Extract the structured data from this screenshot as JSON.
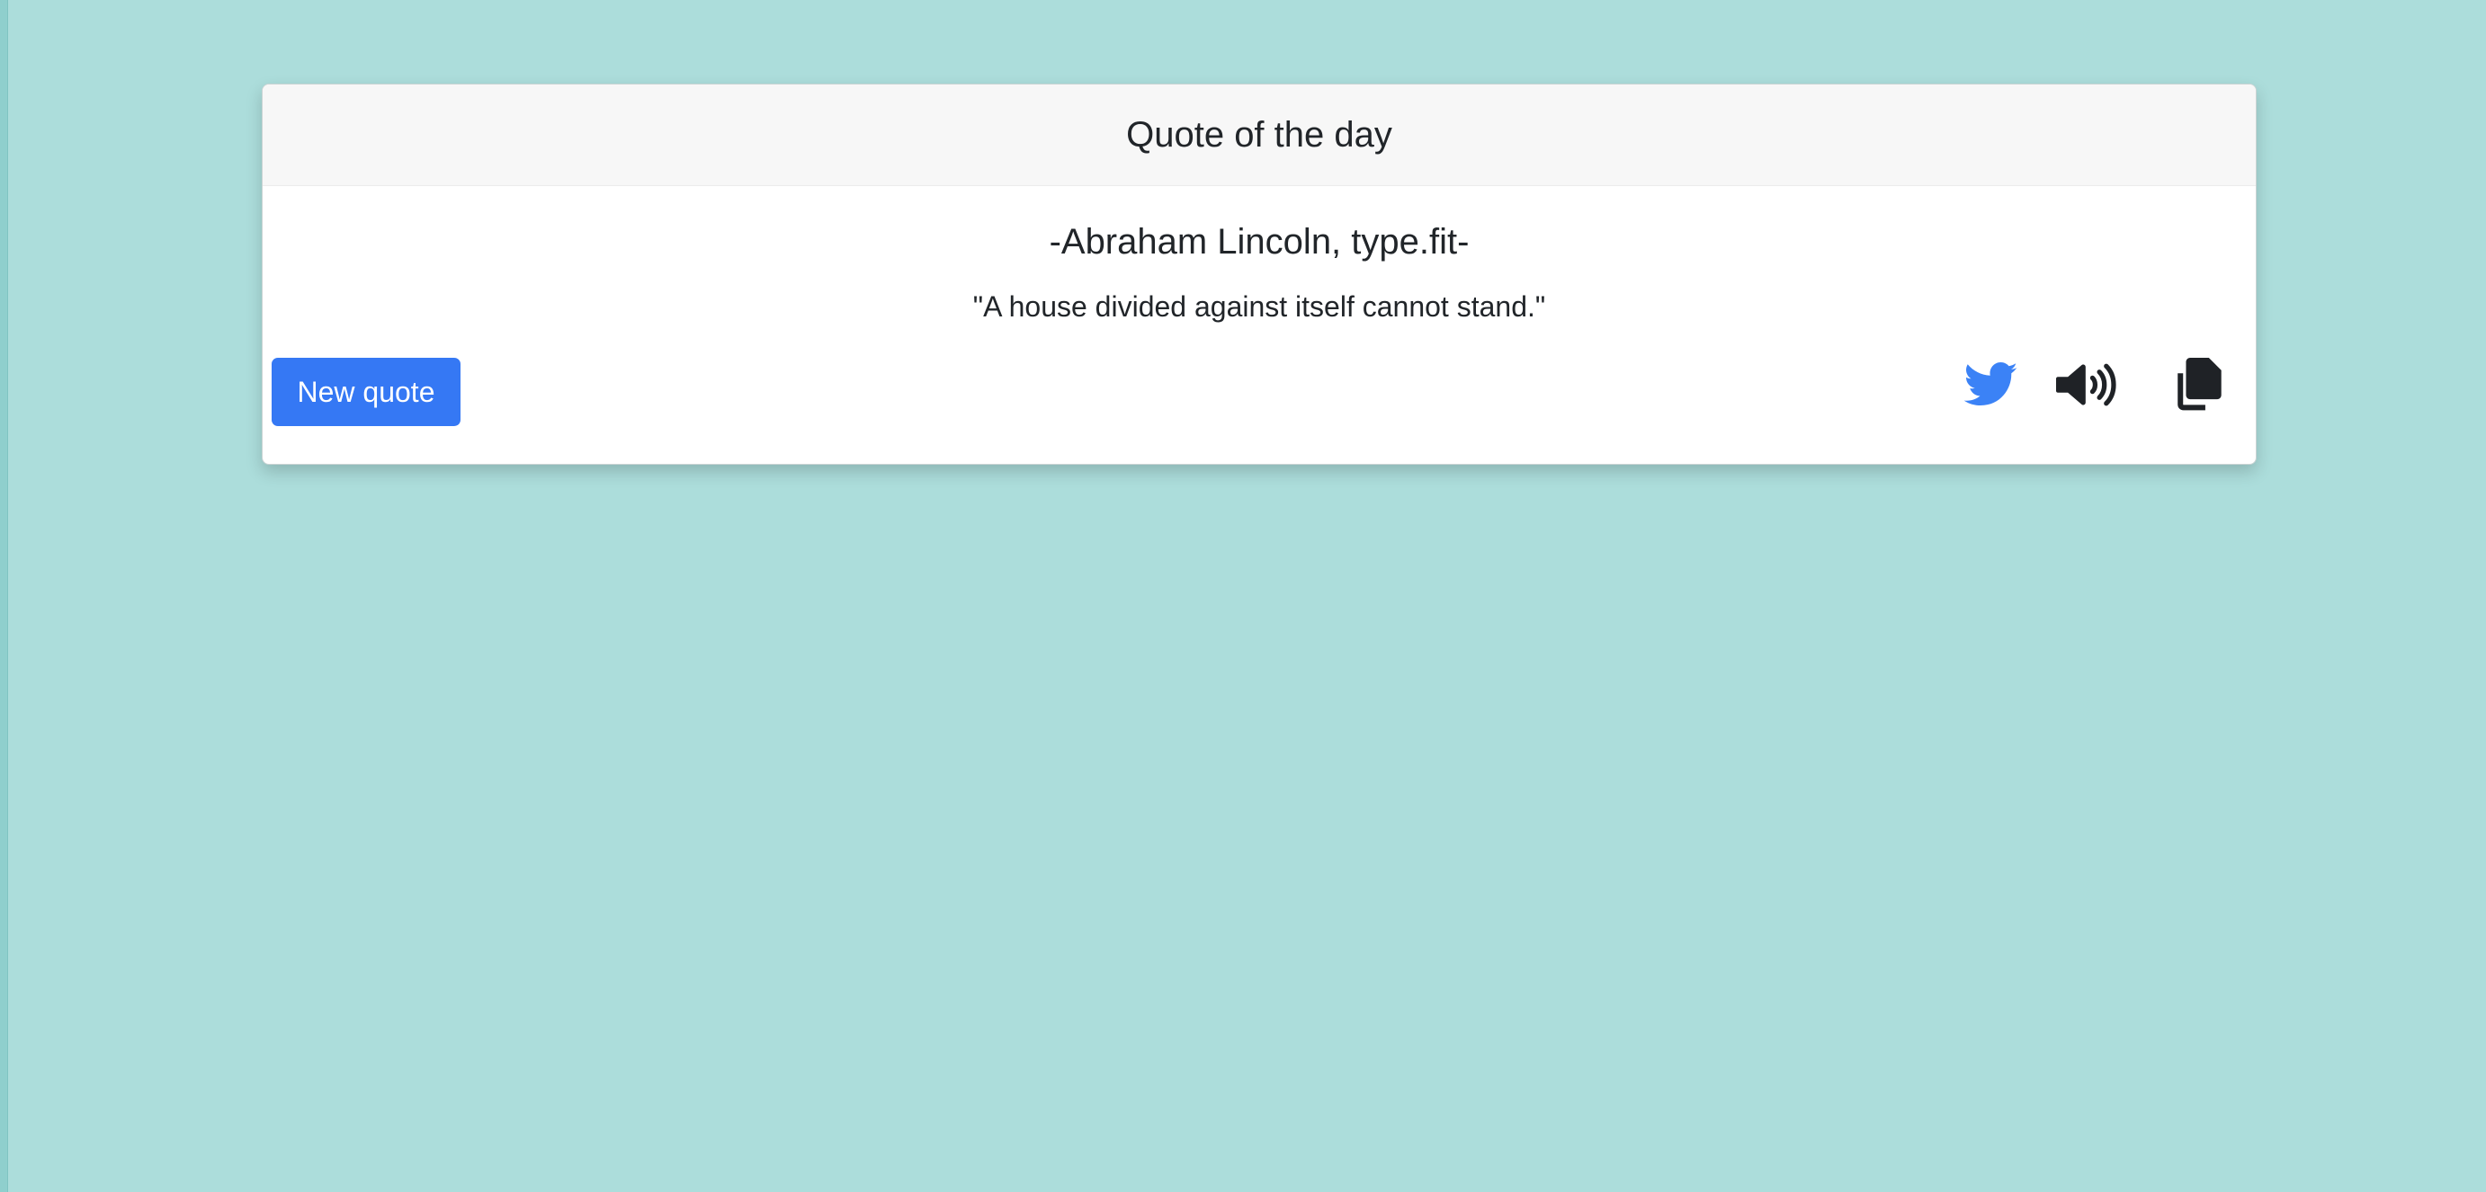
{
  "card": {
    "title": "Quote of the day",
    "author": "-Abraham Lincoln, type.fit-",
    "quote": "\"A house divided against itself cannot stand.\""
  },
  "actions": {
    "new_quote_label": "New quote",
    "icons": [
      "twitter-icon",
      "speaker-icon",
      "copy-icon"
    ]
  },
  "colors": {
    "background": "#acdddb",
    "header_bg": "#f7f7f7",
    "button": "#3578f4",
    "twitter": "#3b82f6",
    "icon_dark": "#1f2226"
  }
}
